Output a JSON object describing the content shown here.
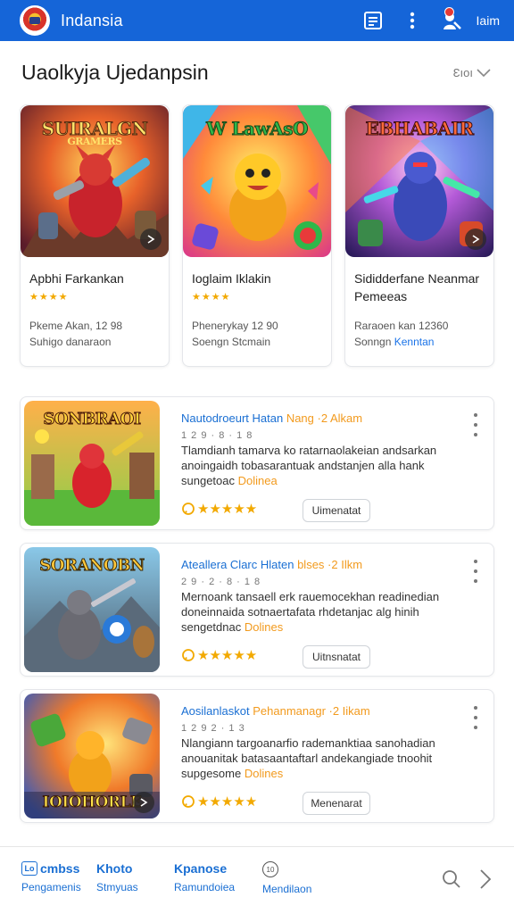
{
  "app": {
    "title": "Indansia",
    "account_label": "Iaim"
  },
  "section": {
    "title": "Uaolkyja Ujedanpsin",
    "more_label": "Ɛıoı"
  },
  "featured": [
    {
      "thumb_title": "SUIRALGN",
      "thumb_subtitle": "GRAMERS",
      "title": "Apbhi Farkankan",
      "stars": "★★★★",
      "meta_line1": "Pkeme Akan, 12 98",
      "meta_line2": "Suhigo danaraon",
      "meta_line2_highlight": ""
    },
    {
      "thumb_title": "W LawAsO",
      "thumb_subtitle": "",
      "title": "Ioglaim Iklakin",
      "stars": "★★★★",
      "meta_line1": "Phenerykay 12 90",
      "meta_line2": "Soengn Stcmain",
      "meta_line2_highlight": ""
    },
    {
      "thumb_title": "EBHABAIR",
      "thumb_subtitle": "",
      "title": "Sididderfane Neanmar Pemeeas",
      "stars": "",
      "meta_line1": "Raraoen kan 12360",
      "meta_line2": "Sonngn ",
      "meta_line2_highlight": "Kenntan"
    }
  ],
  "list": [
    {
      "thumb_title": "SONBRAOI",
      "thumb_subtitle": "",
      "title": "Nautodroeurt Hatan",
      "title_highlight": "Nang ·2 Alkam",
      "subtitle": "1 2 9 · 8 · 1 8",
      "desc": "Tlamdianh tamarva ko ratarnaolakeian andsarkan anoingaidh tobasarantuak andstanjen alla hank sungetoac",
      "desc_highlight": "Dolinea",
      "rating": "★★★★★",
      "button": "Uimenatat"
    },
    {
      "thumb_title": "SORANOBN",
      "thumb_subtitle": "",
      "title": "Ateallera Clarc Hlaten",
      "title_highlight": "blses ·2 Ilkm",
      "subtitle": "2 9 · 2 · 8 · 1 8",
      "desc": "Mernoank tansaell erk rauemocekhan readinedian doneinnaida sotnaertafata rhdetanjac alg hinih sengetdnac",
      "desc_highlight": "Dolines",
      "rating": "★★★★★",
      "button": "Uitnsnatat"
    },
    {
      "thumb_title": "IOIOHORLE",
      "thumb_subtitle": "",
      "title": "Aosilanlaskot",
      "title_highlight": "Pehanmanagr ·2 Iikam",
      "subtitle": "1 2 9 2 · 1 3",
      "desc": "Nlangiann targoanarfio rademanktiaa sanohadian anouanitak batasaantaftarl andekangiade tnoohit supgesome",
      "desc_highlight": "Dolines",
      "rating": "★★★★★",
      "button": "Menenarat"
    }
  ],
  "bottom_nav": [
    {
      "top": "cmbss",
      "bottom": "Pengamenis",
      "icon": "box-icon",
      "icon_text": "Lo"
    },
    {
      "top": "Khoto",
      "bottom": "Stmyuas",
      "icon": ""
    },
    {
      "top": "Kpanose",
      "bottom": "Ramundoiea",
      "icon": ""
    },
    {
      "top": "",
      "bottom": "Mendilaon",
      "icon": "circle-icon",
      "icon_text": "10"
    }
  ],
  "colors": {
    "primary": "#1565d8",
    "link": "#1a6fd3",
    "star": "#f2a900",
    "highlight": "#f29a1d"
  }
}
